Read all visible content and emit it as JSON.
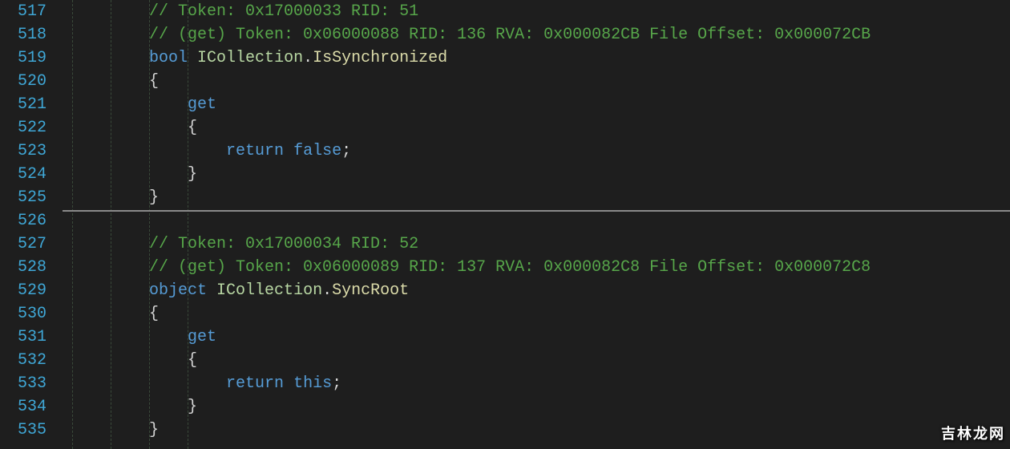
{
  "editor": {
    "line_numbers": [
      "517",
      "518",
      "519",
      "520",
      "521",
      "522",
      "523",
      "524",
      "525",
      "526",
      "527",
      "528",
      "529",
      "530",
      "531",
      "532",
      "533",
      "534",
      "535"
    ],
    "watermark": "吉林龙网",
    "indent_guides": [
      0,
      48,
      96,
      144
    ],
    "divider_after_index": 8
  },
  "code": {
    "lines": [
      {
        "indent": 2,
        "tokens": [
          {
            "t": "comment",
            "v": "// Token: 0x17000033 RID: 51"
          }
        ]
      },
      {
        "indent": 2,
        "tokens": [
          {
            "t": "comment",
            "v": "// (get) Token: 0x06000088 RID: 136 RVA: 0x000082CB File Offset: 0x000072CB"
          }
        ]
      },
      {
        "indent": 2,
        "tokens": [
          {
            "t": "keyword",
            "v": "bool"
          },
          {
            "t": "text",
            "v": " "
          },
          {
            "t": "type",
            "v": "ICollection"
          },
          {
            "t": "punct",
            "v": "."
          },
          {
            "t": "member",
            "v": "IsSynchronized"
          }
        ]
      },
      {
        "indent": 2,
        "tokens": [
          {
            "t": "punct",
            "v": "{"
          }
        ]
      },
      {
        "indent": 3,
        "tokens": [
          {
            "t": "keyword",
            "v": "get"
          }
        ]
      },
      {
        "indent": 3,
        "tokens": [
          {
            "t": "punct",
            "v": "{"
          }
        ]
      },
      {
        "indent": 4,
        "tokens": [
          {
            "t": "keyword",
            "v": "return"
          },
          {
            "t": "text",
            "v": " "
          },
          {
            "t": "keyword",
            "v": "false"
          },
          {
            "t": "punct",
            "v": ";"
          }
        ]
      },
      {
        "indent": 3,
        "tokens": [
          {
            "t": "punct",
            "v": "}"
          }
        ]
      },
      {
        "indent": 2,
        "tokens": [
          {
            "t": "punct",
            "v": "}"
          }
        ]
      },
      {
        "indent": 0,
        "tokens": []
      },
      {
        "indent": 2,
        "tokens": [
          {
            "t": "comment",
            "v": "// Token: 0x17000034 RID: 52"
          }
        ]
      },
      {
        "indent": 2,
        "tokens": [
          {
            "t": "comment",
            "v": "// (get) Token: 0x06000089 RID: 137 RVA: 0x000082C8 File Offset: 0x000072C8"
          }
        ]
      },
      {
        "indent": 2,
        "tokens": [
          {
            "t": "keyword",
            "v": "object"
          },
          {
            "t": "text",
            "v": " "
          },
          {
            "t": "type",
            "v": "ICollection"
          },
          {
            "t": "punct",
            "v": "."
          },
          {
            "t": "member",
            "v": "SyncRoot"
          }
        ]
      },
      {
        "indent": 2,
        "tokens": [
          {
            "t": "punct",
            "v": "{"
          }
        ]
      },
      {
        "indent": 3,
        "tokens": [
          {
            "t": "keyword",
            "v": "get"
          }
        ]
      },
      {
        "indent": 3,
        "tokens": [
          {
            "t": "punct",
            "v": "{"
          }
        ]
      },
      {
        "indent": 4,
        "tokens": [
          {
            "t": "keyword",
            "v": "return"
          },
          {
            "t": "text",
            "v": " "
          },
          {
            "t": "keyword",
            "v": "this"
          },
          {
            "t": "punct",
            "v": ";"
          }
        ]
      },
      {
        "indent": 3,
        "tokens": [
          {
            "t": "punct",
            "v": "}"
          }
        ]
      },
      {
        "indent": 2,
        "tokens": [
          {
            "t": "punct",
            "v": "}"
          }
        ]
      }
    ]
  }
}
